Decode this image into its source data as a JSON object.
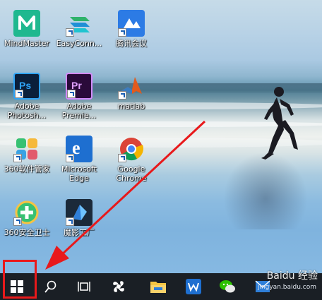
{
  "desktop": {
    "icons": [
      {
        "label": "MindMaster",
        "icon": "mindmaster-icon"
      },
      {
        "label": "EasyConn...",
        "icon": "easyconnect-icon"
      },
      {
        "label": "腾讯会议",
        "icon": "tencent-meeting-icon"
      },
      {
        "label": "Adobe\nPhotosh...",
        "icon": "photoshop-icon"
      },
      {
        "label": "Adobe\nPremie...",
        "icon": "premiere-icon"
      },
      {
        "label": "matlab",
        "icon": "matlab-icon"
      },
      {
        "label": "360软件管家",
        "icon": "360-software-manager-icon"
      },
      {
        "label": "Microsoft\nEdge",
        "icon": "edge-icon"
      },
      {
        "label": "Google\nChrome",
        "icon": "chrome-icon"
      },
      {
        "label": "360安全卫士",
        "icon": "360-security-icon"
      },
      {
        "label": "魔影工厂",
        "icon": "moying-factory-icon"
      }
    ]
  },
  "taskbar": {
    "items": [
      "windows-start-icon",
      "search-icon",
      "task-view-icon",
      "fan-app-icon",
      "file-explorer-icon",
      "wps-icon",
      "wechat-icon",
      "mail-icon"
    ]
  },
  "watermark": {
    "text": "Baidu 经验",
    "url": "jingyan.baidu.com"
  },
  "colors": {
    "highlight": "#e8191b",
    "taskbar": "#1a1f25"
  }
}
